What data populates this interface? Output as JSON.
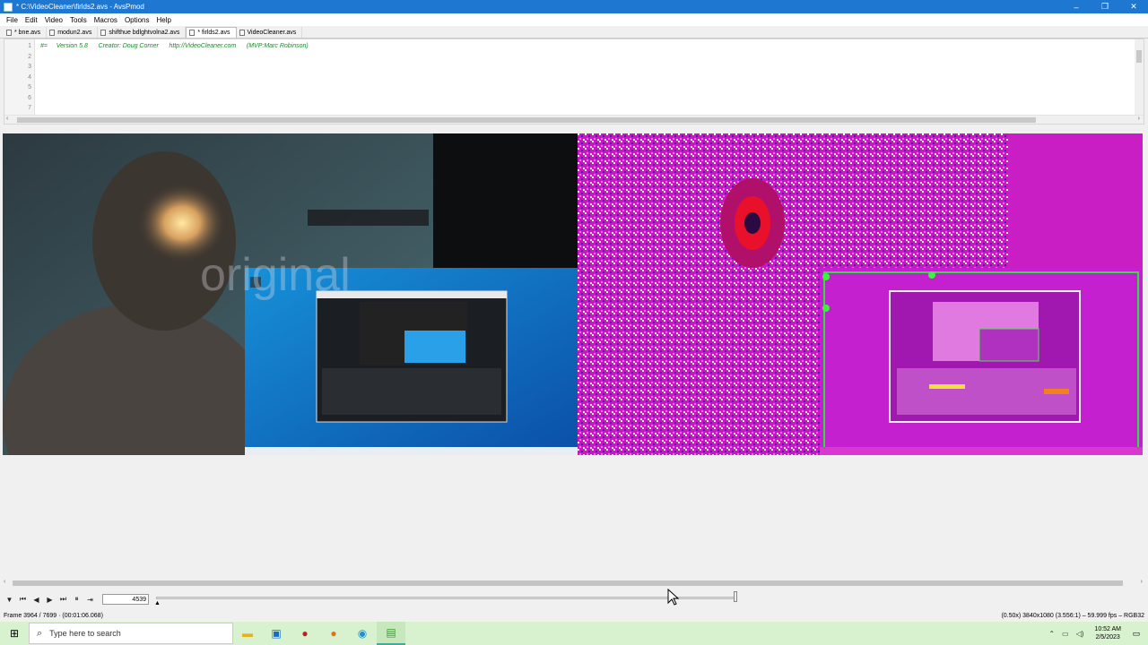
{
  "window": {
    "title": "* C:\\VideoCleaner\\firlds2.avs - AvsPmod",
    "minimize": "–",
    "restore": "❐",
    "close": "✕"
  },
  "menu": [
    "File",
    "Edit",
    "Video",
    "Tools",
    "Macros",
    "Options",
    "Help"
  ],
  "tabs": [
    {
      "label": "* bne.avs",
      "active": false
    },
    {
      "label": "modun2.avs",
      "active": false
    },
    {
      "label": "shifthue bdlghtvolna2.avs",
      "active": false
    },
    {
      "label": "* firlds2.avs",
      "active": true
    },
    {
      "label": "VideoCleaner.avs",
      "active": false
    }
  ],
  "editor": {
    "line_numbers": [
      "1",
      "2",
      "3",
      "4",
      "5",
      "6",
      "7"
    ],
    "code_line_1": "#=     Version 5.8      Creator: Doug Corner      http://VideoCleaner.com      (MVP:Marc Robinson)"
  },
  "preview": {
    "left_overlay_text": "original"
  },
  "controls": {
    "buttons": [
      "▼",
      "⏮",
      "◀",
      "▶",
      "⏭",
      "⏸",
      "⇥"
    ],
    "frame_value": "4539"
  },
  "status": {
    "left": "Frame 3964 / 7699  ·  (00:01:06.068)",
    "right": "(0.50x)  3840x1080 (3.556:1)  –  59.999 fps  –  RGB32"
  },
  "taskbar": {
    "search_placeholder": "Type here to search",
    "time": "10:52 AM",
    "date": "2/5/2023"
  },
  "colors": {
    "titlebar": "#1e78d2",
    "taskbar": "#d8f2d0",
    "magenta": "#d41ec8"
  }
}
